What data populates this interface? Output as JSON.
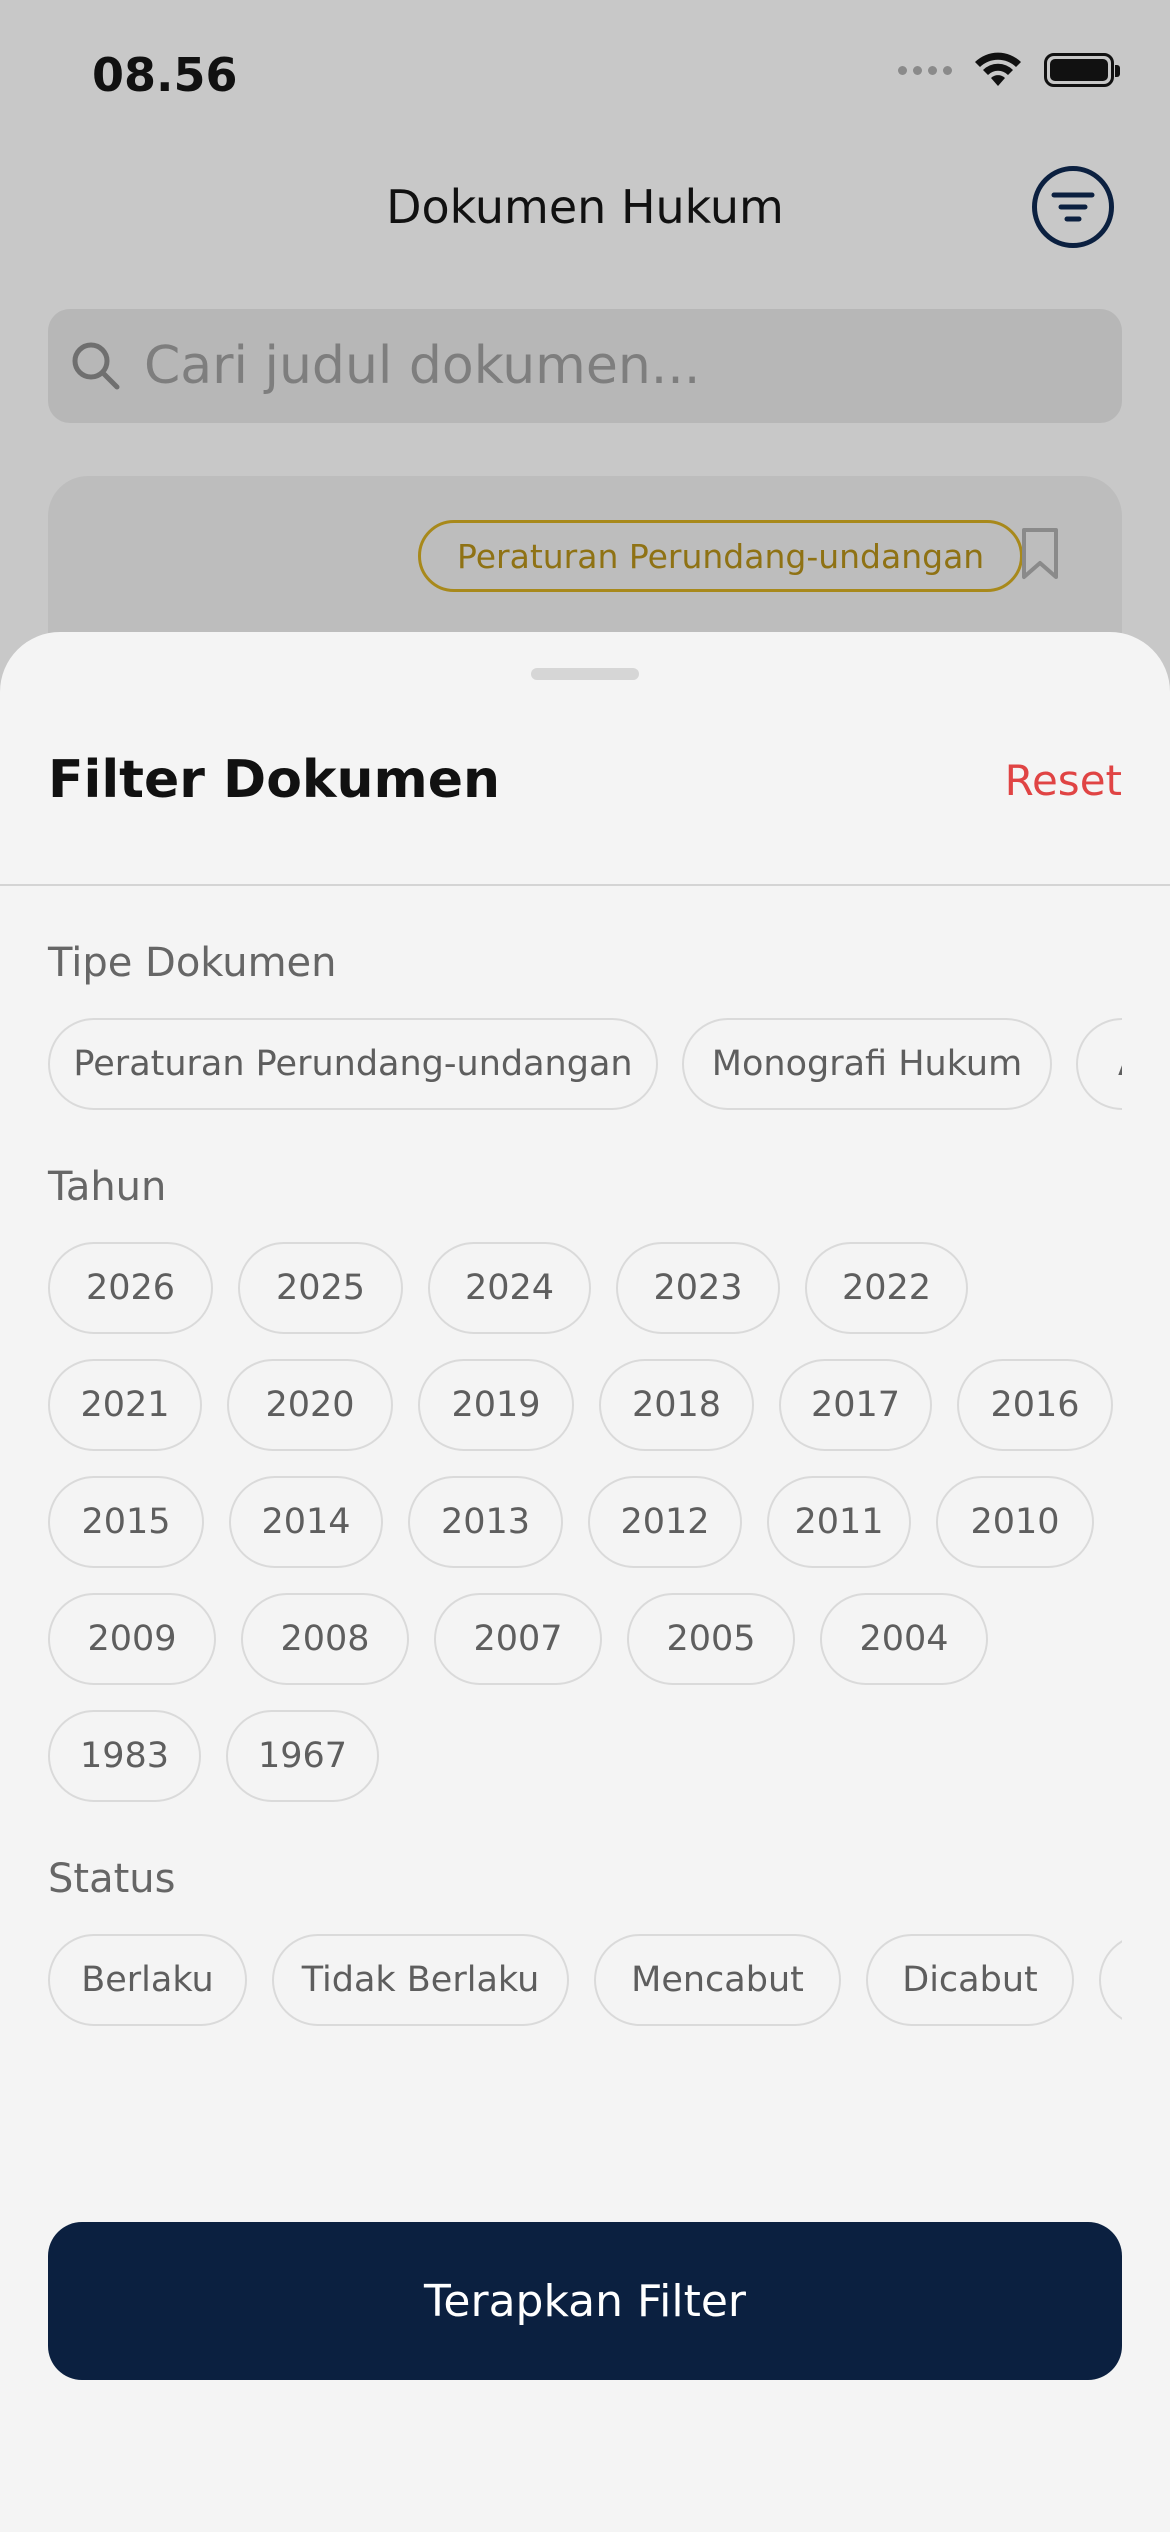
{
  "status_bar": {
    "time": "08.56"
  },
  "header": {
    "title": "Dokumen Hukum"
  },
  "search": {
    "placeholder": "Cari judul dokumen..."
  },
  "card": {
    "badge": "Peraturan Perundang-undangan"
  },
  "sheet": {
    "title": "Filter Dokumen",
    "reset": "Reset",
    "type_label": "Tipe Dokumen",
    "types": [
      "Peraturan Perundang-undangan",
      "Monografi Hukum",
      "A"
    ],
    "year_label": "Tahun",
    "years": [
      "2026",
      "2025",
      "2024",
      "2023",
      "2022",
      "2021",
      "2020",
      "2019",
      "2018",
      "2017",
      "2016",
      "2015",
      "2014",
      "2013",
      "2012",
      "2011",
      "2010",
      "2009",
      "2008",
      "2007",
      "2005",
      "2004",
      "1983",
      "1967"
    ],
    "status_label": "Status",
    "statuses": [
      "Berlaku",
      "Tidak Berlaku",
      "Mencabut",
      "Dicabut",
      ""
    ],
    "apply": "Terapkan Filter"
  },
  "colors": {
    "primary": "#0b2040",
    "reset": "#e04444",
    "badge": "#a8891b"
  }
}
